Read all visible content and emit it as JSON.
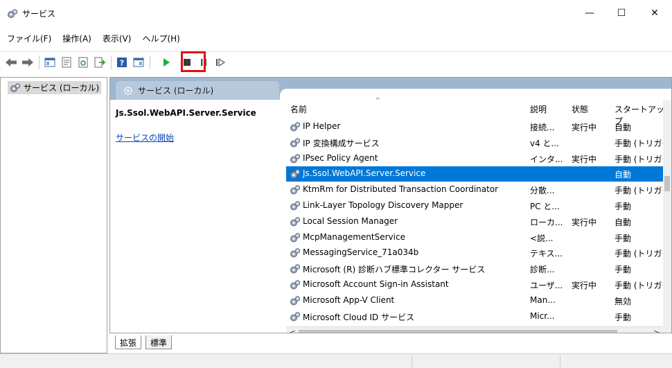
{
  "window": {
    "title": "サービス",
    "minimize": "—",
    "maximize": "☐",
    "close": "✕"
  },
  "menu": [
    "ファイル(F)",
    "操作(A)",
    "表示(V)",
    "ヘルプ(H)"
  ],
  "toolbar": {
    "buttons": [
      "back-icon",
      "forward-icon",
      "show-hide-console-tree-icon",
      "properties-icon",
      "refresh-icon",
      "export-list-icon",
      "help-icon",
      "show-hide-action-pane-icon",
      "start-service-icon",
      "stop-service-icon",
      "pause-service-icon",
      "restart-service-icon"
    ],
    "highlighted": "start-service-icon",
    "highlight_color": "#e01010"
  },
  "tree": {
    "root_label": "サービス (ローカル)"
  },
  "panel": {
    "header": "サービス (ローカル)",
    "selected_service": "Js.Ssol.WebAPI.Server.Service",
    "start_link": "サービスの開始"
  },
  "table": {
    "columns": [
      "名前",
      "説明",
      "状態",
      "スタートアップ"
    ],
    "rows": [
      {
        "name": "IP Helper",
        "description": "接続...",
        "status": "実行中",
        "startup": "自動"
      },
      {
        "name": "IP 変換構成サービス",
        "description": "v4 と...",
        "status": "",
        "startup": "手動 (トリガー"
      },
      {
        "name": "IPsec Policy Agent",
        "description": "インタ...",
        "status": "実行中",
        "startup": "手動 (トリガー"
      },
      {
        "name": "Js.Ssol.WebAPI.Server.Service",
        "description": "",
        "status": "",
        "startup": "自動"
      },
      {
        "name": "KtmRm for Distributed Transaction Coordinator",
        "description": "分散...",
        "status": "",
        "startup": "手動 (トリガー"
      },
      {
        "name": "Link-Layer Topology Discovery Mapper",
        "description": "PC と...",
        "status": "",
        "startup": "手動"
      },
      {
        "name": "Local Session Manager",
        "description": "ローカ...",
        "status": "実行中",
        "startup": "自動"
      },
      {
        "name": "McpManagementService",
        "description": "<説...",
        "status": "",
        "startup": "手動"
      },
      {
        "name": "MessagingService_71a034b",
        "description": "テキス...",
        "status": "",
        "startup": "手動 (トリガー"
      },
      {
        "name": "Microsoft (R) 診断ハブ標準コレクター サービス",
        "description": "診断...",
        "status": "",
        "startup": "手動"
      },
      {
        "name": "Microsoft Account Sign-in Assistant",
        "description": "ユーザ...",
        "status": "実行中",
        "startup": "手動 (トリガー"
      },
      {
        "name": "Microsoft App-V Client",
        "description": "Man...",
        "status": "",
        "startup": "無効"
      },
      {
        "name": "Microsoft Cloud ID サービス",
        "description": "Micr...",
        "status": "",
        "startup": "手動"
      }
    ],
    "selected_index": 3,
    "selection_color": "#0078d7"
  },
  "bottom_tabs": [
    "拡張",
    "標準"
  ]
}
